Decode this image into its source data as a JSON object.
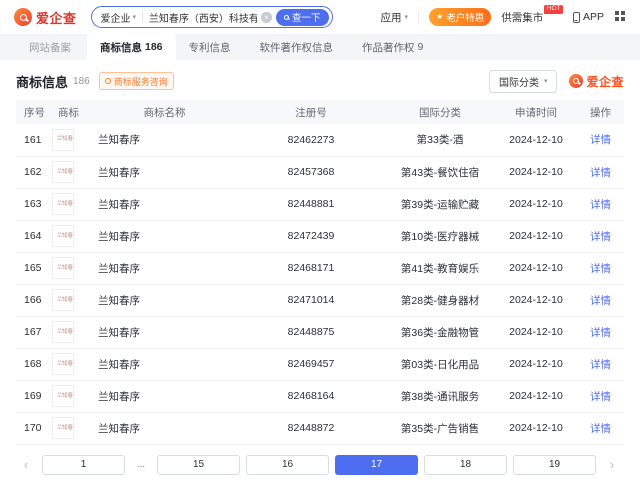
{
  "colors": {
    "accent_blue": "#4e6ef2",
    "brand_red": "#d43b2f",
    "brand_orange": "#ff4f1f",
    "tag_orange": "#ff7c2d",
    "hot_red": "#f53f3f"
  },
  "icons": {
    "caret_down": "▾",
    "clear": "×",
    "promo_star": "★"
  },
  "header": {
    "logo": "爱企查",
    "search": {
      "category": "爱企业",
      "query": "兰知春序（西安）科技有限公司",
      "button": "查一下"
    },
    "nav": {
      "app_menu": "应用",
      "promo": "老户特惠",
      "market": "供需集市",
      "market_badge": "HOT",
      "app_download": "APP"
    }
  },
  "tabs": [
    {
      "label": "网站备案",
      "muted": true
    },
    {
      "label": "商标信息",
      "count": "186",
      "active": true
    },
    {
      "label": "专利信息"
    },
    {
      "label": "软件著作权信息"
    },
    {
      "label": "作品著作权",
      "count": "9"
    }
  ],
  "section": {
    "title": "商标信息",
    "count": "186",
    "tag": "商标服务咨询",
    "filter_label": "国际分类",
    "brand": "爱企查"
  },
  "table": {
    "headers": [
      "序号",
      "商标",
      "商标名称",
      "注册号",
      "国际分类",
      "申请时间",
      "操作"
    ],
    "rows": [
      {
        "no": "161",
        "mark": "兰知春序",
        "name": "兰知春序",
        "reg_no": "82462273",
        "intl_class": "第33类-酒",
        "apply_date": "2024-12-10",
        "action": "详情"
      },
      {
        "no": "162",
        "mark": "兰知春序",
        "name": "兰知春序",
        "reg_no": "82457368",
        "intl_class": "第43类-餐饮住宿",
        "apply_date": "2024-12-10",
        "action": "详情"
      },
      {
        "no": "163",
        "mark": "兰知春序",
        "name": "兰知春序",
        "reg_no": "82448881",
        "intl_class": "第39类-运输贮藏",
        "apply_date": "2024-12-10",
        "action": "详情"
      },
      {
        "no": "164",
        "mark": "兰知春序",
        "name": "兰知春序",
        "reg_no": "82472439",
        "intl_class": "第10类-医疗器械",
        "apply_date": "2024-12-10",
        "action": "详情"
      },
      {
        "no": "165",
        "mark": "兰知春序",
        "name": "兰知春序",
        "reg_no": "82468171",
        "intl_class": "第41类-教育娱乐",
        "apply_date": "2024-12-10",
        "action": "详情"
      },
      {
        "no": "166",
        "mark": "兰知春序",
        "name": "兰知春序",
        "reg_no": "82471014",
        "intl_class": "第28类-健身器材",
        "apply_date": "2024-12-10",
        "action": "详情"
      },
      {
        "no": "167",
        "mark": "兰知春序",
        "name": "兰知春序",
        "reg_no": "82448875",
        "intl_class": "第36类-金融物管",
        "apply_date": "2024-12-10",
        "action": "详情"
      },
      {
        "no": "168",
        "mark": "兰知春序",
        "name": "兰知春序",
        "reg_no": "82469457",
        "intl_class": "第03类-日化用品",
        "apply_date": "2024-12-10",
        "action": "详情"
      },
      {
        "no": "169",
        "mark": "兰知春序",
        "name": "兰知春序",
        "reg_no": "82468164",
        "intl_class": "第38类-通讯服务",
        "apply_date": "2024-12-10",
        "action": "详情"
      },
      {
        "no": "170",
        "mark": "兰知春序",
        "name": "兰知春序",
        "reg_no": "82448872",
        "intl_class": "第35类-广告销售",
        "apply_date": "2024-12-10",
        "action": "详情"
      }
    ]
  },
  "pagination": {
    "items": [
      {
        "label": "‹",
        "type": "prev"
      },
      {
        "label": "1",
        "type": "page"
      },
      {
        "label": "...",
        "type": "ellipsis"
      },
      {
        "label": "15",
        "type": "page"
      },
      {
        "label": "16",
        "type": "page"
      },
      {
        "label": "17",
        "type": "page",
        "active": true
      },
      {
        "label": "18",
        "type": "page"
      },
      {
        "label": "19",
        "type": "page"
      },
      {
        "label": "›",
        "type": "next"
      }
    ]
  }
}
